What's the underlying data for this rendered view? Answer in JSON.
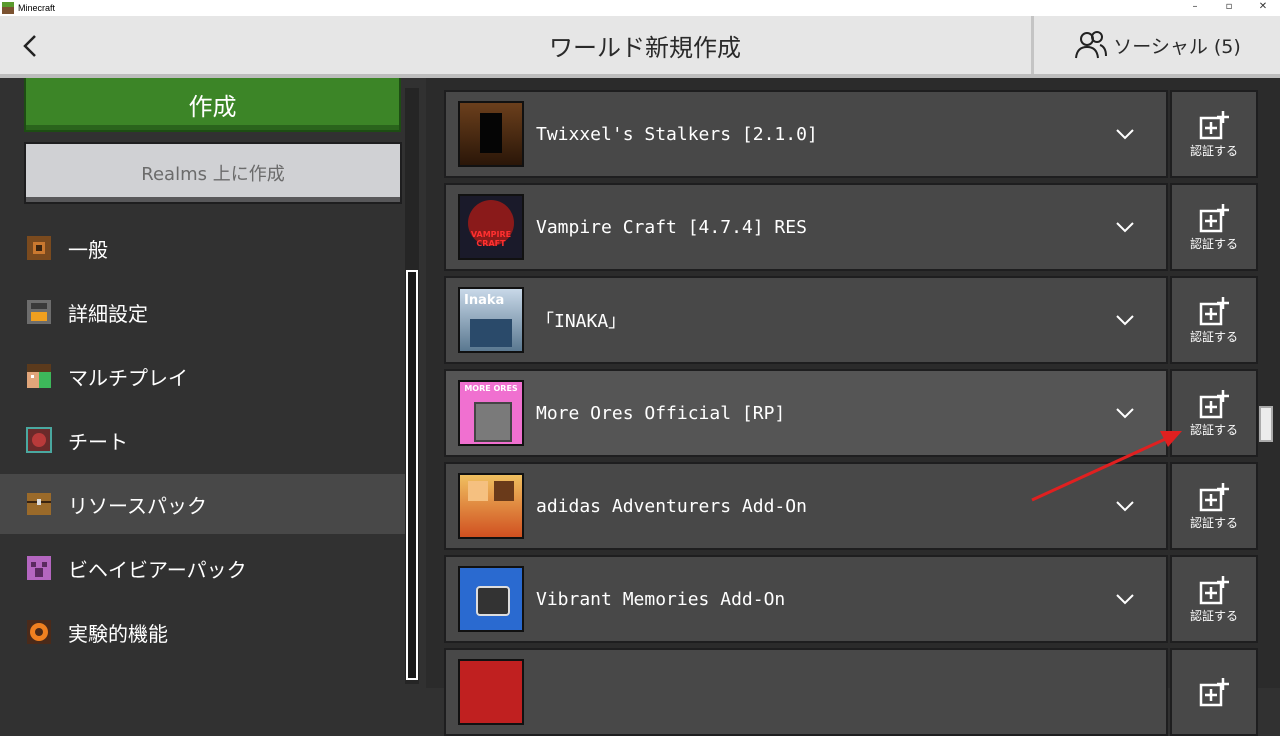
{
  "window": {
    "title": "Minecraft",
    "controls": [
      "–",
      "▫",
      "✕"
    ]
  },
  "header": {
    "title": "ワールド新規作成",
    "social_label": "ソーシャル (5)"
  },
  "sidebar": {
    "create_label": "作成",
    "realms_label": "Realms 上に作成",
    "items": [
      {
        "label": "一般",
        "icon": "gear-icon"
      },
      {
        "label": "詳細設定",
        "icon": "furnace-icon"
      },
      {
        "label": "マルチプレイ",
        "icon": "players-icon"
      },
      {
        "label": "チート",
        "icon": "command-block-icon"
      },
      {
        "label": "リソースパック",
        "icon": "chest-icon",
        "active": true
      },
      {
        "label": "ビヘイビアーパック",
        "icon": "creeper-icon"
      },
      {
        "label": "実験的機能",
        "icon": "flask-icon"
      }
    ]
  },
  "packs": [
    {
      "name": "Twixxel's Stalkers [2.1.0]",
      "action": "認証する"
    },
    {
      "name": "Vampire Craft [4.7.4] RES",
      "action": "認証する",
      "icon_text": "VAMPIRE CRAFT"
    },
    {
      "name": "「INAKA」",
      "action": "認証する",
      "icon_text": "Inaka"
    },
    {
      "name": "More Ores Official [RP]",
      "action": "認証する",
      "icon_text": "MORE ORES"
    },
    {
      "name": "adidas Adventurers Add-On",
      "action": "認証する"
    },
    {
      "name": "Vibrant Memories Add-On",
      "action": "認証する"
    },
    {
      "name": "",
      "action": ""
    }
  ]
}
